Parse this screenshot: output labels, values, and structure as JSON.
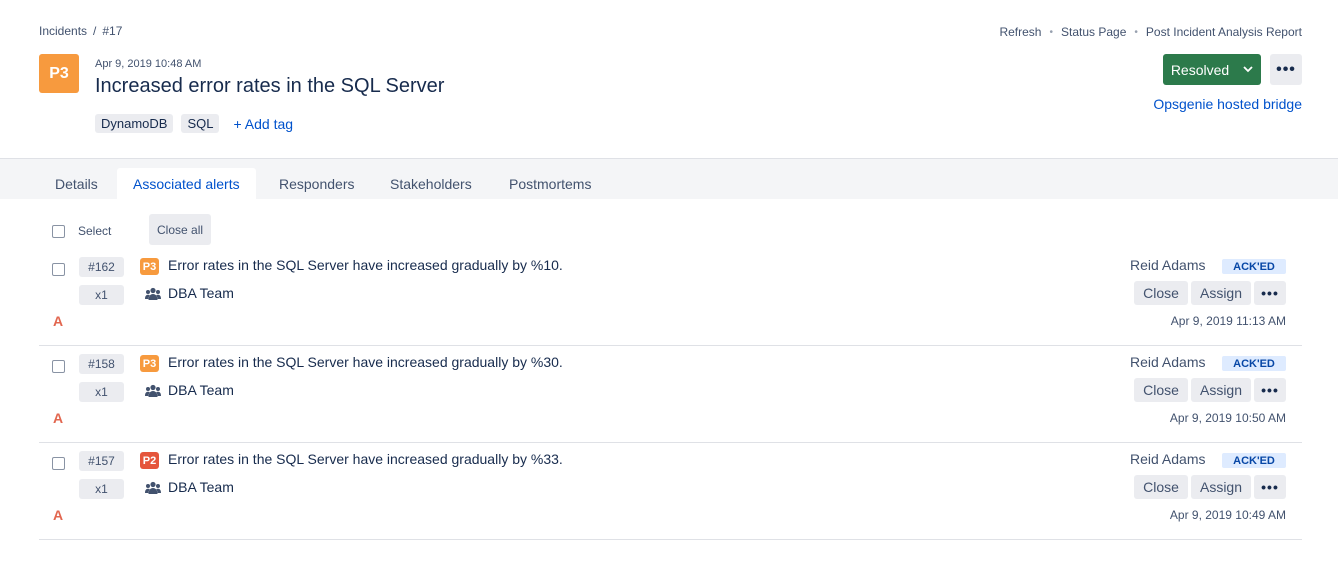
{
  "breadcrumb": {
    "root": "Incidents",
    "separator": "/",
    "current": "#17"
  },
  "top_actions": [
    "Refresh",
    "Status Page",
    "Post Incident Analysis Report"
  ],
  "incident": {
    "priority": "P3",
    "date": "Apr 9, 2019 10:48 AM",
    "title": "Increased error rates in the SQL Server",
    "tags": [
      "DynamoDB",
      "SQL"
    ],
    "add_tag_label": "+ Add tag",
    "status_label": "Resolved",
    "more_label": "•••",
    "bridge_link": "Opsgenie hosted bridge"
  },
  "tabs": [
    "Details",
    "Associated alerts",
    "Responders",
    "Stakeholders",
    "Postmortems"
  ],
  "active_tab": "Associated alerts",
  "list": {
    "select_label": "Select",
    "close_all_label": "Close all"
  },
  "alerts": [
    {
      "id": "#162",
      "count": "x1",
      "priority": "P3",
      "priority_color": "#f79a3e",
      "message": "Error rates in the SQL Server have increased gradually by %10.",
      "team": "DBA Team",
      "source": "A",
      "owner": "Reid Adams",
      "status": "ACK'ED",
      "close_label": "Close",
      "assign_label": "Assign",
      "more_label": "•••",
      "date": "Apr 9, 2019 11:13 AM"
    },
    {
      "id": "#158",
      "count": "x1",
      "priority": "P3",
      "priority_color": "#f79a3e",
      "message": "Error rates in the SQL Server have increased gradually by %30.",
      "team": "DBA Team",
      "source": "A",
      "owner": "Reid Adams",
      "status": "ACK'ED",
      "close_label": "Close",
      "assign_label": "Assign",
      "more_label": "•••",
      "date": "Apr 9, 2019 10:50 AM"
    },
    {
      "id": "#157",
      "count": "x1",
      "priority": "P2",
      "priority_color": "#e5553b",
      "message": "Error rates in the SQL Server have increased gradually by %33.",
      "team": "DBA Team",
      "source": "A",
      "owner": "Reid Adams",
      "status": "ACK'ED",
      "close_label": "Close",
      "assign_label": "Assign",
      "more_label": "•••",
      "date": "Apr 9, 2019 10:49 AM"
    }
  ],
  "colors": {
    "accent": "#0052cc",
    "resolved": "#2c7a4b",
    "p3": "#f79a3e",
    "p2": "#e5553b",
    "ack_bg": "#deebff",
    "ack_text": "#0747a6"
  },
  "icons": {
    "team": "people-group-icon",
    "chevron": "chevron-down-icon",
    "more": "more-horizontal-icon"
  }
}
